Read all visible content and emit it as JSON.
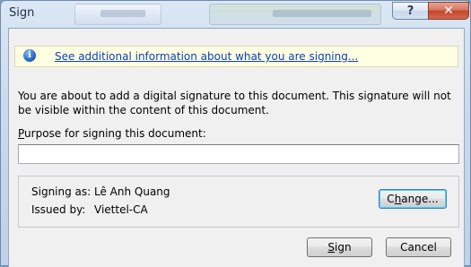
{
  "window": {
    "title": "Sign",
    "help_glyph": "?",
    "close_glyph": "✕"
  },
  "infobar": {
    "icon": "info-icon",
    "link_text": "See additional information about what you are signing..."
  },
  "description": "You are about to add a digital signature to this document. This signature will not be visible within the content of this document.",
  "purpose": {
    "label_prefix": "P",
    "label_rest": "urpose for signing this document:",
    "value": ""
  },
  "signer": {
    "signing_as_label": "Signing as:",
    "signing_as_value": "Lê Anh Quang",
    "issued_by_label": "Issued by:",
    "issued_by_value": "Viettel-CA",
    "change_prefix": "C",
    "change_mnemonic": "h",
    "change_rest": "ange..."
  },
  "buttons": {
    "sign_mnemonic": "S",
    "sign_rest": "ign",
    "cancel": "Cancel"
  },
  "colors": {
    "link": "#0b3fbd",
    "infobar_bg": "#ffffe1",
    "close_button": "#c4442a"
  }
}
